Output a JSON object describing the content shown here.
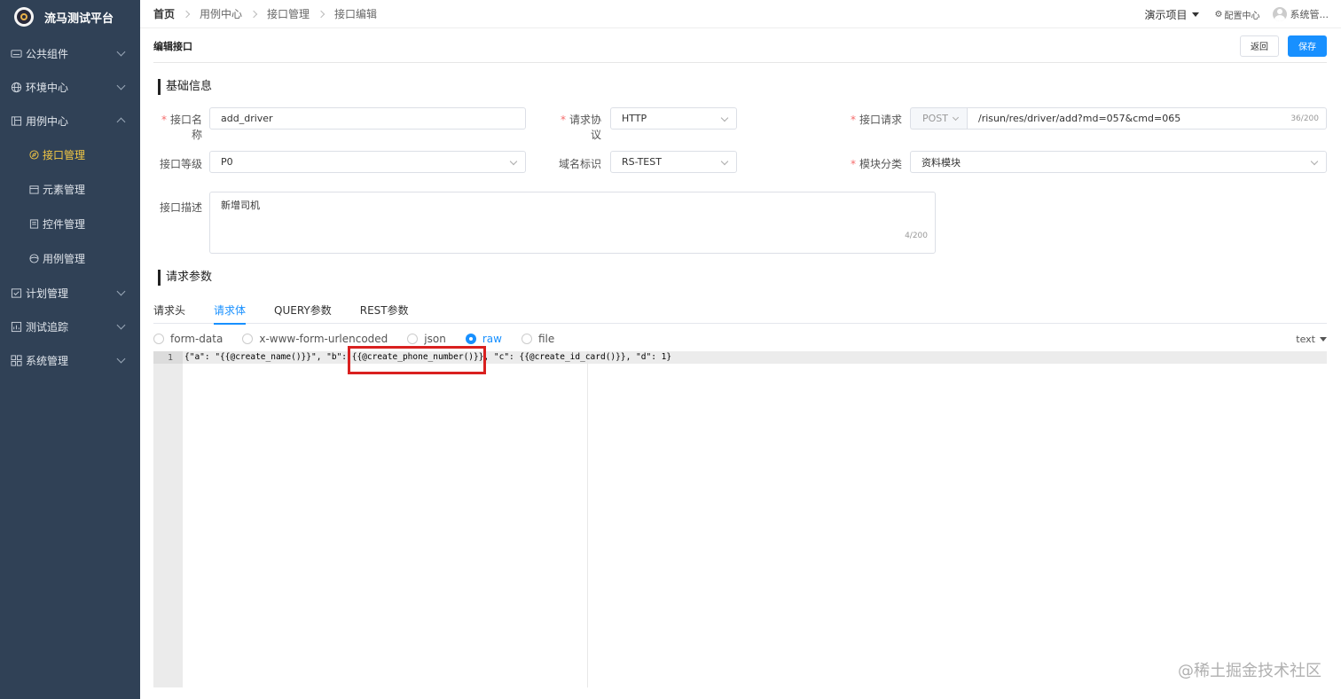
{
  "app": {
    "title": "流马测试平台"
  },
  "sidebar": {
    "items": [
      {
        "label": "公共组件"
      },
      {
        "label": "环境中心"
      },
      {
        "label": "用例中心"
      },
      {
        "label": "计划管理"
      },
      {
        "label": "测试追踪"
      },
      {
        "label": "系统管理"
      }
    ],
    "sub_items": [
      {
        "label": "接口管理"
      },
      {
        "label": "元素管理"
      },
      {
        "label": "控件管理"
      },
      {
        "label": "用例管理"
      }
    ]
  },
  "breadcrumb": [
    "首页",
    "用例中心",
    "接口管理",
    "接口编辑"
  ],
  "topbar": {
    "project": "演示项目",
    "config": "配置中心",
    "user": "系统管..."
  },
  "page": {
    "title": "编辑接口",
    "back_label": "返回",
    "save_label": "保存"
  },
  "basic": {
    "section_title": "基础信息",
    "name_label": "接口名称",
    "name_value": "add_driver",
    "protocol_label": "请求协议",
    "protocol_value": "HTTP",
    "request_label": "接口请求",
    "method_value": "POST",
    "url_value": "/risun/res/driver/add?md=057&cmd=065",
    "url_counter": "36/200",
    "level_label": "接口等级",
    "level_value": "P0",
    "domain_label": "域名标识",
    "domain_value": "RS-TEST",
    "module_label": "模块分类",
    "module_value": "资料模块",
    "desc_label": "接口描述",
    "desc_value": "新增司机",
    "desc_counter": "4/200"
  },
  "params": {
    "section_title": "请求参数",
    "tabs": [
      "请求头",
      "请求体",
      "QUERY参数",
      "REST参数"
    ],
    "body_types": [
      "form-data",
      "x-www-form-urlencoded",
      "json",
      "raw",
      "file"
    ],
    "mode": "text",
    "line_number": "1",
    "code": "{\"a\": \"{{@create_name()}}\", \"b\": {{@create_phone_number()}}, \"c\": {{@create_id_card()}}, \"d\": 1}"
  },
  "watermark": "@稀土掘金技术社区"
}
